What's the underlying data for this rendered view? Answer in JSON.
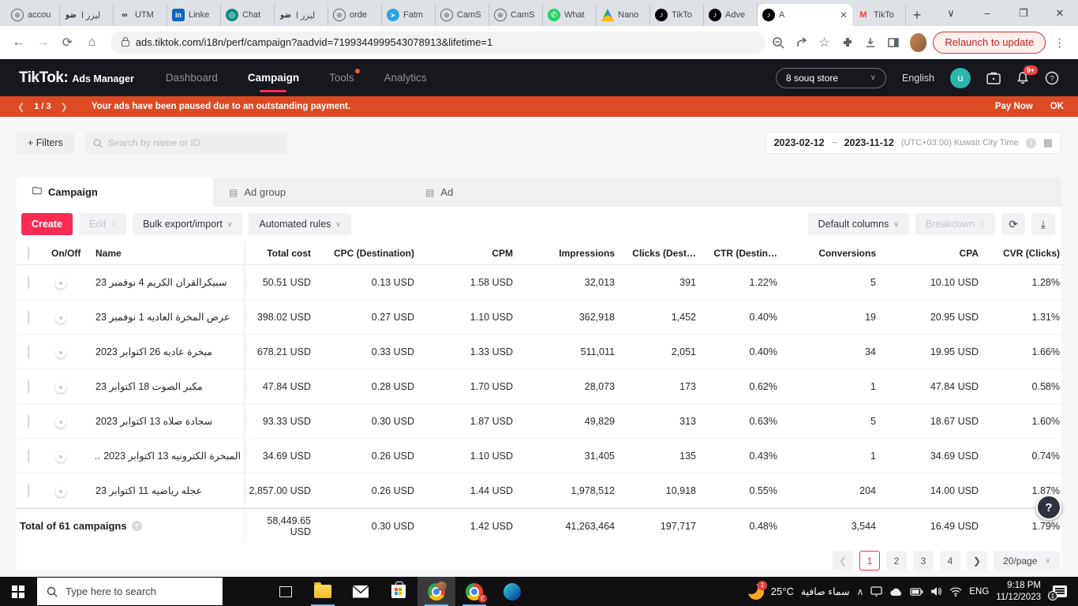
{
  "browser": {
    "tabs": [
      {
        "title": "accou"
      },
      {
        "title": "ليزر ا"
      },
      {
        "title": "UTM"
      },
      {
        "title": "Linke"
      },
      {
        "title": "Chat"
      },
      {
        "title": "ليزر ا"
      },
      {
        "title": "orde"
      },
      {
        "title": "Fatm"
      },
      {
        "title": "CamS"
      },
      {
        "title": "CamS"
      },
      {
        "title": "What"
      },
      {
        "title": "Nano"
      },
      {
        "title": "TikTo"
      },
      {
        "title": "Adve"
      },
      {
        "title": "A"
      },
      {
        "title": "TikTo"
      }
    ],
    "url": "ads.tiktok.com/i18n/perf/campaign?aadvid=7199344999543078913&lifetime=1",
    "relaunch_label": "Relaunch to update"
  },
  "header": {
    "logo": "TikTok:",
    "logo_suffix": "Ads Manager",
    "nav_dashboard": "Dashboard",
    "nav_campaign": "Campaign",
    "nav_tools": "Tools",
    "nav_analytics": "Analytics",
    "account": "8 souq store",
    "language": "English",
    "avatar": "u",
    "notif_badge": "9+"
  },
  "banner": {
    "pager": "1 / 3",
    "message": "Your ads have been paused due to an outstanding payment.",
    "pay_now": "Pay Now",
    "ok": "OK"
  },
  "filters": {
    "filters_label": "+ Filters",
    "search_placeholder": "Search by name or ID",
    "date_start": "2023-02-12",
    "date_tilde": "~",
    "date_end": "2023-11-12",
    "timezone": "(UTC+03:00) Kuwait City Time"
  },
  "tabs": {
    "campaign": "Campaign",
    "ad_group": "Ad group",
    "ad": "Ad"
  },
  "toolbar": {
    "create": "Create",
    "edit": "Edit",
    "bulk": "Bulk export/import",
    "rules": "Automated rules",
    "columns": "Default columns",
    "breakdown": "Breakdown"
  },
  "table": {
    "headers": {
      "on_off": "On/Off",
      "name": "Name",
      "total_cost": "Total cost",
      "cpc": "CPC (Destination)",
      "cpm": "CPM",
      "impressions": "Impressions",
      "clicks": "Clicks (Dest…",
      "ctr": "CTR (Destin…",
      "conversions": "Conversions",
      "cpa": "CPA",
      "cvr": "CVR (Clicks)"
    },
    "rows": [
      {
        "name": "سبيكرالقران الكريم 4 نوفمبر 23",
        "cost": "50.51 USD",
        "cpc": "0.13 USD",
        "cpm": "1.58 USD",
        "impressions": "32,013",
        "clicks": "391",
        "ctr": "1.22%",
        "conversions": "5",
        "cpa": "10.10 USD",
        "cvr": "1.28%"
      },
      {
        "name": "عرض المخرة العاديه 1 نوفمبر 23",
        "cost": "398.02 USD",
        "cpc": "0.27 USD",
        "cpm": "1.10 USD",
        "impressions": "362,918",
        "clicks": "1,452",
        "ctr": "0.40%",
        "conversions": "19",
        "cpa": "20.95 USD",
        "cvr": "1.31%"
      },
      {
        "name": "مبخرة عاديه 26 اكتوابر 2023",
        "cost": "678.21 USD",
        "cpc": "0.33 USD",
        "cpm": "1.33 USD",
        "impressions": "511,011",
        "clicks": "2,051",
        "ctr": "0.40%",
        "conversions": "34",
        "cpa": "19.95 USD",
        "cvr": "1.66%"
      },
      {
        "name": "مكبر الصوت 18 اكتوابر 23",
        "cost": "47.84 USD",
        "cpc": "0.28 USD",
        "cpm": "1.70 USD",
        "impressions": "28,073",
        "clicks": "173",
        "ctr": "0.62%",
        "conversions": "1",
        "cpa": "47.84 USD",
        "cvr": "0.58%"
      },
      {
        "name": "سجادة صلاه 13 اكتوابر 2023",
        "cost": "93.33 USD",
        "cpc": "0.30 USD",
        "cpm": "1.87 USD",
        "impressions": "49,829",
        "clicks": "313",
        "ctr": "0.63%",
        "conversions": "5",
        "cpa": "18.67 USD",
        "cvr": "1.60%"
      },
      {
        "name": "المبخرة الكترونيه 13 اكتوابر 2023 …",
        "cost": "34.69 USD",
        "cpc": "0.26 USD",
        "cpm": "1.10 USD",
        "impressions": "31,405",
        "clicks": "135",
        "ctr": "0.43%",
        "conversions": "1",
        "cpa": "34.69 USD",
        "cvr": "0.74%"
      },
      {
        "name": "عجله رياضيه 11 اكتوابر 23",
        "cost": "2,857.00 USD",
        "cpc": "0.26 USD",
        "cpm": "1.44 USD",
        "impressions": "1,978,512",
        "clicks": "10,918",
        "ctr": "0.55%",
        "conversions": "204",
        "cpa": "14.00 USD",
        "cvr": "1.87%"
      }
    ],
    "total": {
      "label": "Total of 61 campaigns",
      "cost": "58,449.65 USD",
      "cpc": "0.30 USD",
      "cpm": "1.42 USD",
      "impressions": "41,263,464",
      "clicks": "197,717",
      "ctr": "0.48%",
      "conversions": "3,544",
      "cpa": "16.49 USD",
      "cvr": "1.79%"
    }
  },
  "pagination": {
    "pages": [
      "1",
      "2",
      "3",
      "4"
    ],
    "per_page": "20/page"
  },
  "help": {
    "label": "?"
  },
  "taskbar": {
    "search_placeholder": "Type here to search",
    "temp": "25°C",
    "weather": "سماء صافية",
    "weather_badge": "1",
    "lang": "ENG",
    "time": "9:18 PM",
    "date": "11/12/2023",
    "notif_badge": "1"
  },
  "colors": {
    "accent_pink": "#fe2c55",
    "banner_orange": "#dd4b24",
    "header_black": "#17181d",
    "avatar_teal": "#2bb3ad",
    "relaunch_red": "#d93025"
  },
  "icons": {
    "tiktok-note": "♪",
    "search": "magnifier",
    "calendar": "▦",
    "refresh": "⟳",
    "export": "⤓",
    "chevron-down": "∨",
    "folder": "folder-shape",
    "bell": "bell-shape",
    "help": "?"
  }
}
